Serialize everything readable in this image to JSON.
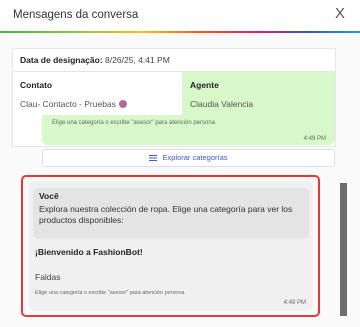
{
  "header": {
    "title": "Mensagens da conversa",
    "close_label": "X"
  },
  "info": {
    "assignment_label": "Data de designação:",
    "assignment_value": "8/26/25, 4:41 PM",
    "contact_label": "Contato",
    "contact_value": "Clau- Contacto - Pruebas",
    "agent_label": "Agente",
    "agent_value": "Claudia Valencia"
  },
  "prev_message": {
    "hint": "Elige una categoría o escribe \"asesor\" para atención persona",
    "time": "4:49 PM"
  },
  "explore_button": {
    "label": "Explorar categorías",
    "icon": "list-icon"
  },
  "highlighted_message": {
    "sender": "Você",
    "text": "Explora nuestra colección de ropa. Elige una categoría para ver los productos disponibles:",
    "welcome": "¡Bienvenido a FashionBot!",
    "category": "Faldas",
    "hint": "Elige una categoría o escribe \"asesor\" para atención persona",
    "time": "4:49 PM"
  },
  "colors": {
    "agent_bg": "#d7f8c8",
    "highlight_border": "#e53935",
    "link_blue": "#3a5bd9"
  }
}
